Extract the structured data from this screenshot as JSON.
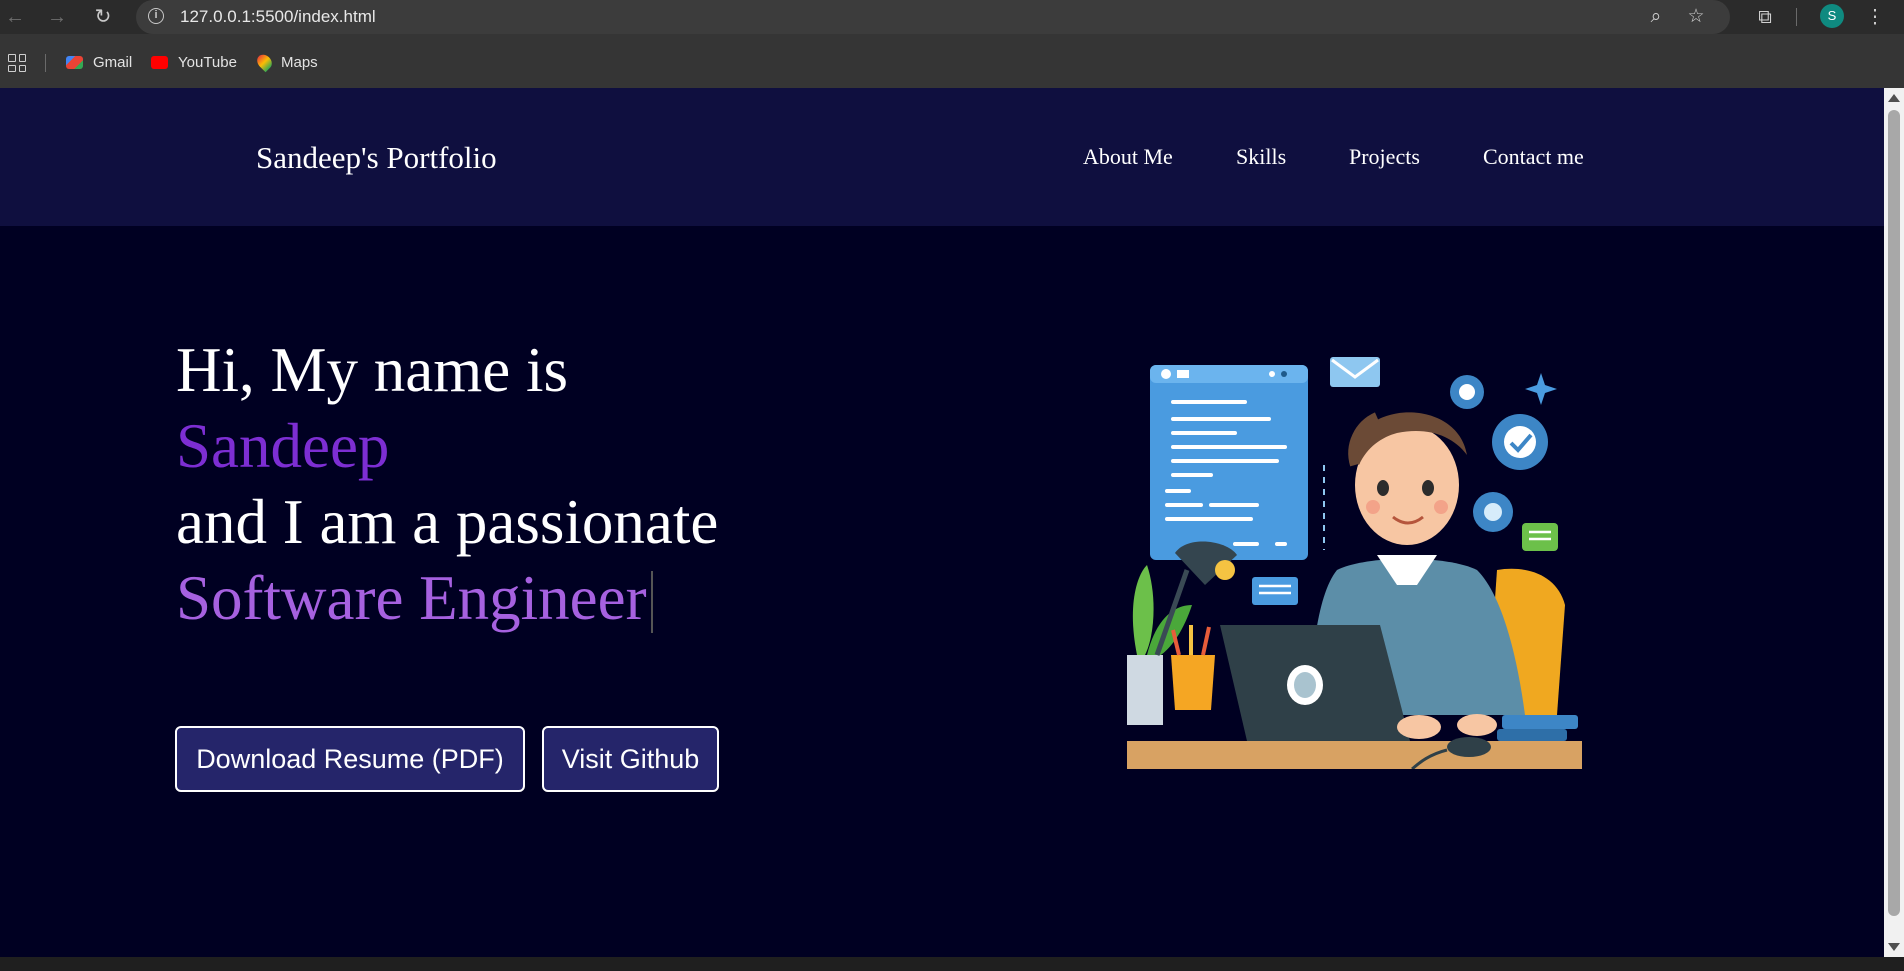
{
  "browser": {
    "url": "127.0.0.1:5500/index.html",
    "profile_initial": "S",
    "bookmarks": [
      {
        "label": "Gmail",
        "icon": "gmail-icon",
        "color": "#ea4335"
      },
      {
        "label": "YouTube",
        "icon": "youtube-icon",
        "color": "#ff0000"
      },
      {
        "label": "Maps",
        "icon": "maps-icon",
        "color": "#34a853"
      }
    ]
  },
  "header": {
    "brand": "Sandeep's Portfolio",
    "nav": [
      "About Me",
      "Skills",
      "Projects",
      "Contact me"
    ]
  },
  "hero": {
    "line1": "Hi, My name is",
    "name": "Sandeep",
    "line3": "and I am a passionate",
    "role": "Software Engineer",
    "buttons": [
      "Download Resume (PDF)",
      "Visit Github"
    ],
    "illustration": "developer-at-laptop-illustration"
  },
  "colors": {
    "background": "#000022",
    "header": "#0f0f3f",
    "name_accent": "#7d2ed3",
    "role_accent": "#a661e0",
    "button_bg": "#25256a"
  }
}
